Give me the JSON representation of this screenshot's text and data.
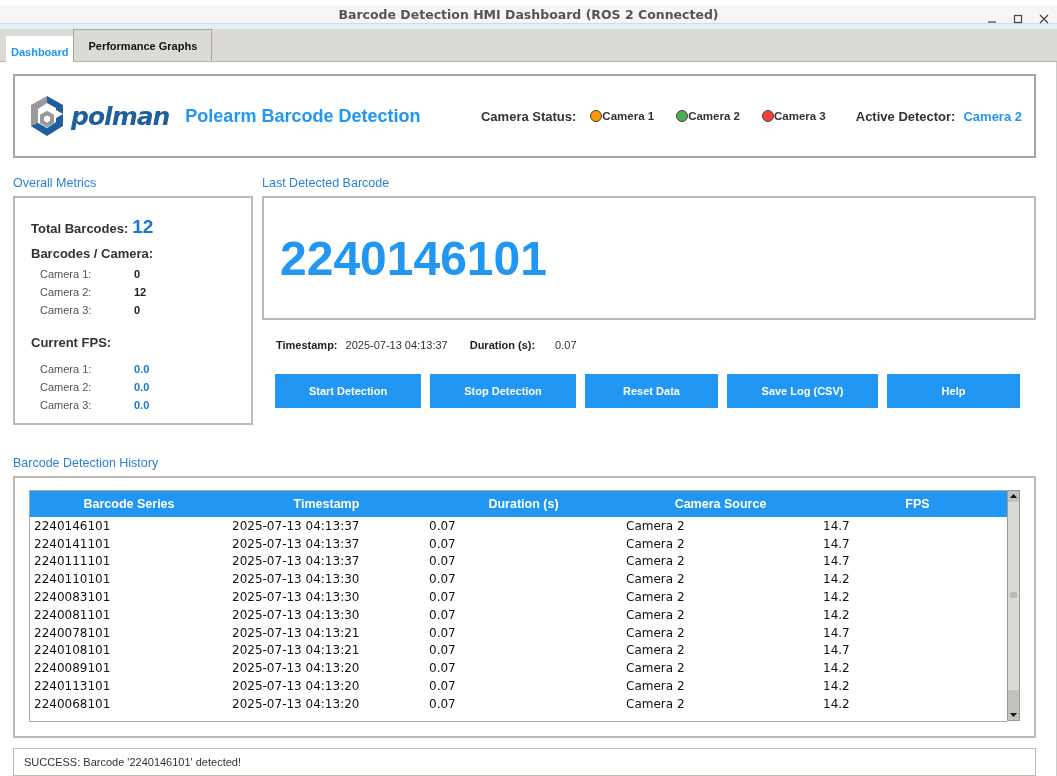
{
  "window": {
    "title": "Barcode Detection HMI Dashboard (ROS 2 Connected)"
  },
  "tabs": [
    {
      "label": "Dashboard",
      "selected": true
    },
    {
      "label": "Performance Graphs",
      "selected": false
    }
  ],
  "header": {
    "logo_text": "polman",
    "app_title": "Polearm Barcode Detection",
    "camera_status_label": "Camera Status:",
    "cameras": [
      {
        "name": "Camera 1",
        "color": "#ff9800"
      },
      {
        "name": "Camera 2",
        "color": "#4caf50"
      },
      {
        "name": "Camera 3",
        "color": "#f44336"
      }
    ],
    "active_detector_label": "Active Detector:",
    "active_detector": "Camera 2"
  },
  "overall_metrics": {
    "title": "Overall Metrics",
    "total_label": "Total Barcodes:",
    "total": "12",
    "per_camera_label": "Barcodes / Camera:",
    "per_camera": [
      {
        "label": "Camera 1:",
        "value": "0"
      },
      {
        "label": "Camera 2:",
        "value": "12"
      },
      {
        "label": "Camera 3:",
        "value": "0"
      }
    ],
    "fps_label": "Current FPS:",
    "fps": [
      {
        "label": "Camera 1:",
        "value": "0.0"
      },
      {
        "label": "Camera 2:",
        "value": "0.0"
      },
      {
        "label": "Camera 3:",
        "value": "0.0"
      }
    ]
  },
  "last_detected": {
    "title": "Last Detected Barcode",
    "barcode": "2240146101",
    "timestamp_label": "Timestamp:",
    "timestamp": "2025-07-13 04:13:37",
    "duration_label": "Duration (s):",
    "duration": "0.07"
  },
  "buttons": [
    "Start Detection",
    "Stop Detection",
    "Reset Data",
    "Save Log (CSV)",
    "Help"
  ],
  "history": {
    "title": "Barcode Detection History",
    "columns": [
      "Barcode Series",
      "Timestamp",
      "Duration (s)",
      "Camera Source",
      "FPS"
    ],
    "rows": [
      [
        "2240146101",
        "2025-07-13 04:13:37",
        "0.07",
        "Camera 2",
        "14.7"
      ],
      [
        "2240141101",
        "2025-07-13 04:13:37",
        "0.07",
        "Camera 2",
        "14.7"
      ],
      [
        "2240111101",
        "2025-07-13 04:13:37",
        "0.07",
        "Camera 2",
        "14.7"
      ],
      [
        "2240110101",
        "2025-07-13 04:13:30",
        "0.07",
        "Camera 2",
        "14.2"
      ],
      [
        "2240083101",
        "2025-07-13 04:13:30",
        "0.07",
        "Camera 2",
        "14.2"
      ],
      [
        "2240081101",
        "2025-07-13 04:13:30",
        "0.07",
        "Camera 2",
        "14.2"
      ],
      [
        "2240078101",
        "2025-07-13 04:13:21",
        "0.07",
        "Camera 2",
        "14.7"
      ],
      [
        "2240108101",
        "2025-07-13 04:13:21",
        "0.07",
        "Camera 2",
        "14.7"
      ],
      [
        "2240089101",
        "2025-07-13 04:13:20",
        "0.07",
        "Camera 2",
        "14.2"
      ],
      [
        "2240113101",
        "2025-07-13 04:13:20",
        "0.07",
        "Camera 2",
        "14.2"
      ],
      [
        "2240068101",
        "2025-07-13 04:13:20",
        "0.07",
        "Camera 2",
        "14.2"
      ]
    ]
  },
  "status_bar": "SUCCESS: Barcode '2240146101' detected!"
}
